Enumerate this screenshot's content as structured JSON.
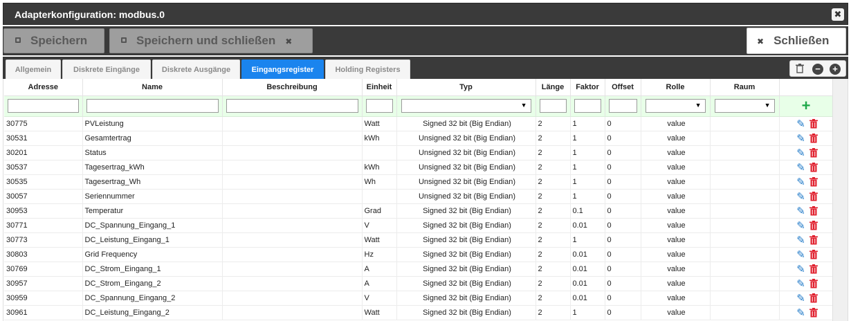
{
  "window": {
    "title": "Adapterkonfiguration: modbus.0",
    "close_glyph": "✖"
  },
  "toolbar": {
    "save_label": "Speichern",
    "save_close_label": "Speichern und schließen",
    "close_label": "Schließen",
    "x_glyph": "✖"
  },
  "tabs": [
    {
      "label": "Allgemein",
      "active": false
    },
    {
      "label": "Diskrete Eingänge",
      "active": false
    },
    {
      "label": "Diskrete Ausgänge",
      "active": false
    },
    {
      "label": "Eingangsregister",
      "active": true
    },
    {
      "label": "Holding Registers",
      "active": false
    }
  ],
  "tab_icons": [
    "trash-icon",
    "minus-circle-icon",
    "plus-circle-icon"
  ],
  "table": {
    "columns": [
      "Adresse",
      "Name",
      "Beschreibung",
      "Einheit",
      "Typ",
      "Länge",
      "Faktor",
      "Offset",
      "Rolle",
      "Raum"
    ],
    "add_glyph": "+",
    "rows": [
      {
        "adresse": "30775",
        "name": "PVLeistung",
        "beschreibung": "",
        "einheit": "Watt",
        "typ": "Signed 32 bit (Big Endian)",
        "laenge": "2",
        "faktor": "1",
        "offset": "0",
        "rolle": "value",
        "raum": ""
      },
      {
        "adresse": "30531",
        "name": "Gesamtertrag",
        "beschreibung": "",
        "einheit": "kWh",
        "typ": "Unsigned 32 bit (Big Endian)",
        "laenge": "2",
        "faktor": "1",
        "offset": "0",
        "rolle": "value",
        "raum": ""
      },
      {
        "adresse": "30201",
        "name": "Status",
        "beschreibung": "",
        "einheit": "",
        "typ": "Unsigned 32 bit (Big Endian)",
        "laenge": "2",
        "faktor": "1",
        "offset": "0",
        "rolle": "value",
        "raum": ""
      },
      {
        "adresse": "30537",
        "name": "Tagesertrag_kWh",
        "beschreibung": "",
        "einheit": "kWh",
        "typ": "Unsigned 32 bit (Big Endian)",
        "laenge": "2",
        "faktor": "1",
        "offset": "0",
        "rolle": "value",
        "raum": ""
      },
      {
        "adresse": "30535",
        "name": "Tagesertrag_Wh",
        "beschreibung": "",
        "einheit": "Wh",
        "typ": "Unsigned 32 bit (Big Endian)",
        "laenge": "2",
        "faktor": "1",
        "offset": "0",
        "rolle": "value",
        "raum": ""
      },
      {
        "adresse": "30057",
        "name": "Seriennummer",
        "beschreibung": "",
        "einheit": "",
        "typ": "Unsigned 32 bit (Big Endian)",
        "laenge": "2",
        "faktor": "1",
        "offset": "0",
        "rolle": "value",
        "raum": ""
      },
      {
        "adresse": "30953",
        "name": "Temperatur",
        "beschreibung": "",
        "einheit": "Grad",
        "typ": "Signed 32 bit (Big Endian)",
        "laenge": "2",
        "faktor": "0.1",
        "offset": "0",
        "rolle": "value",
        "raum": ""
      },
      {
        "adresse": "30771",
        "name": "DC_Spannung_Eingang_1",
        "beschreibung": "",
        "einheit": "V",
        "typ": "Signed 32 bit (Big Endian)",
        "laenge": "2",
        "faktor": "0.01",
        "offset": "0",
        "rolle": "value",
        "raum": ""
      },
      {
        "adresse": "30773",
        "name": "DC_Leistung_Eingang_1",
        "beschreibung": "",
        "einheit": "Watt",
        "typ": "Signed 32 bit (Big Endian)",
        "laenge": "2",
        "faktor": "1",
        "offset": "0",
        "rolle": "value",
        "raum": ""
      },
      {
        "adresse": "30803",
        "name": "Grid Frequency",
        "beschreibung": "",
        "einheit": "Hz",
        "typ": "Signed 32 bit (Big Endian)",
        "laenge": "2",
        "faktor": "0.01",
        "offset": "0",
        "rolle": "value",
        "raum": ""
      },
      {
        "adresse": "30769",
        "name": "DC_Strom_Eingang_1",
        "beschreibung": "",
        "einheit": "A",
        "typ": "Signed 32 bit (Big Endian)",
        "laenge": "2",
        "faktor": "0.01",
        "offset": "0",
        "rolle": "value",
        "raum": ""
      },
      {
        "adresse": "30957",
        "name": "DC_Strom_Eingang_2",
        "beschreibung": "",
        "einheit": "A",
        "typ": "Signed 32 bit (Big Endian)",
        "laenge": "2",
        "faktor": "0.01",
        "offset": "0",
        "rolle": "value",
        "raum": ""
      },
      {
        "adresse": "30959",
        "name": "DC_Spannung_Eingang_2",
        "beschreibung": "",
        "einheit": "V",
        "typ": "Signed 32 bit (Big Endian)",
        "laenge": "2",
        "faktor": "0.01",
        "offset": "0",
        "rolle": "value",
        "raum": ""
      },
      {
        "adresse": "30961",
        "name": "DC_Leistung_Eingang_2",
        "beschreibung": "",
        "einheit": "Watt",
        "typ": "Signed 32 bit (Big Endian)",
        "laenge": "2",
        "faktor": "1",
        "offset": "0",
        "rolle": "value",
        "raum": ""
      }
    ]
  },
  "colors": {
    "active_tab": "#1a84ee",
    "edit": "#1f79c8",
    "delete": "#e0202e",
    "add": "#1fa84a",
    "filter_row": "#e8ffe8"
  }
}
